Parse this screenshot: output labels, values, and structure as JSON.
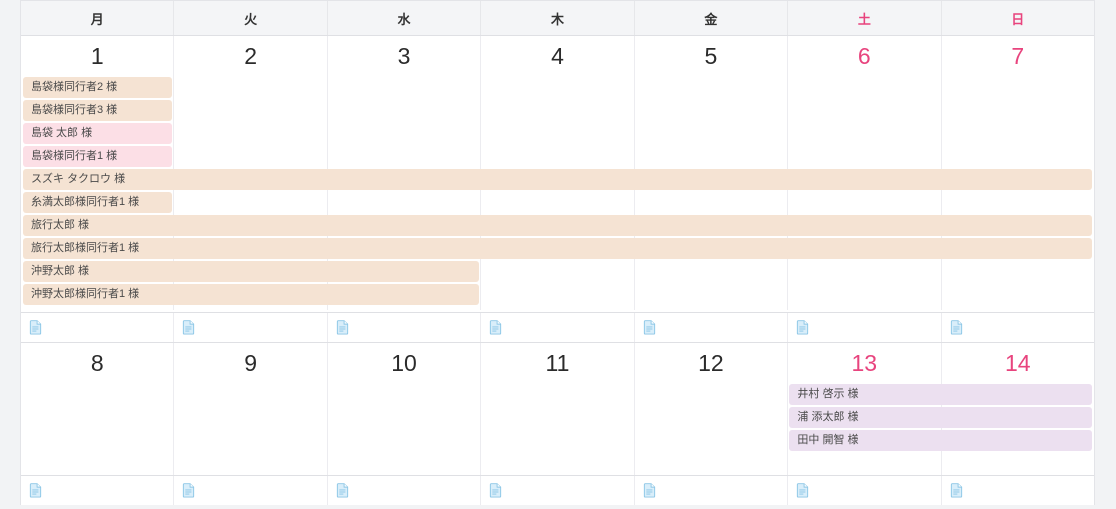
{
  "calendar": {
    "weekdays": [
      {
        "label": "月",
        "type": "weekday"
      },
      {
        "label": "火",
        "type": "weekday"
      },
      {
        "label": "水",
        "type": "weekday"
      },
      {
        "label": "木",
        "type": "weekday"
      },
      {
        "label": "金",
        "type": "weekday"
      },
      {
        "label": "土",
        "type": "saturday"
      },
      {
        "label": "日",
        "type": "sunday"
      }
    ],
    "colors": {
      "beige": "#f5e3d3",
      "pink": "#fcdfe6",
      "purple": "#ece0f0",
      "weekend_text": "#e8447e",
      "header_bg": "#f4f5f7",
      "icon_blue": "#9ccde8",
      "page_bg": "#f2f3f5"
    },
    "icons": {
      "memo": "document-icon"
    },
    "weeks": [
      {
        "days": [
          {
            "num": "1",
            "weekend": false
          },
          {
            "num": "2",
            "weekend": false
          },
          {
            "num": "3",
            "weekend": false
          },
          {
            "num": "4",
            "weekend": false
          },
          {
            "num": "5",
            "weekend": false
          },
          {
            "num": "6",
            "weekend": true
          },
          {
            "num": "7",
            "weekend": true
          }
        ],
        "events": [
          {
            "label": "島袋様同行者2 様",
            "start": 0,
            "span": 1,
            "color": "beige"
          },
          {
            "label": "島袋様同行者3 様",
            "start": 0,
            "span": 1,
            "color": "beige"
          },
          {
            "label": "島袋 太郎 様",
            "start": 0,
            "span": 1,
            "color": "pink"
          },
          {
            "label": "島袋様同行者1 様",
            "start": 0,
            "span": 1,
            "color": "pink"
          },
          {
            "label": "スズキ タクロウ 様",
            "start": 0,
            "span": 7,
            "color": "beige"
          },
          {
            "label": "糸満太郎様同行者1 様",
            "start": 0,
            "span": 1,
            "color": "beige"
          },
          {
            "label": "旅行太郎 様",
            "start": 0,
            "span": 7,
            "color": "beige"
          },
          {
            "label": "旅行太郎様同行者1 様",
            "start": 0,
            "span": 7,
            "color": "beige"
          },
          {
            "label": "沖野太郎 様",
            "start": 0,
            "span": 3,
            "color": "beige"
          },
          {
            "label": "沖野太郎様同行者1 様",
            "start": 0,
            "span": 3,
            "color": "beige"
          }
        ]
      },
      {
        "days": [
          {
            "num": "8",
            "weekend": false
          },
          {
            "num": "9",
            "weekend": false
          },
          {
            "num": "10",
            "weekend": false
          },
          {
            "num": "11",
            "weekend": false
          },
          {
            "num": "12",
            "weekend": false
          },
          {
            "num": "13",
            "weekend": true
          },
          {
            "num": "14",
            "weekend": true
          }
        ],
        "events": [
          {
            "label": "井村 啓示 様",
            "start": 5,
            "span": 2,
            "color": "purple"
          },
          {
            "label": "浦 添太郎 様",
            "start": 5,
            "span": 2,
            "color": "purple"
          },
          {
            "label": "田中 開智 様",
            "start": 5,
            "span": 2,
            "color": "purple"
          }
        ]
      }
    ]
  }
}
